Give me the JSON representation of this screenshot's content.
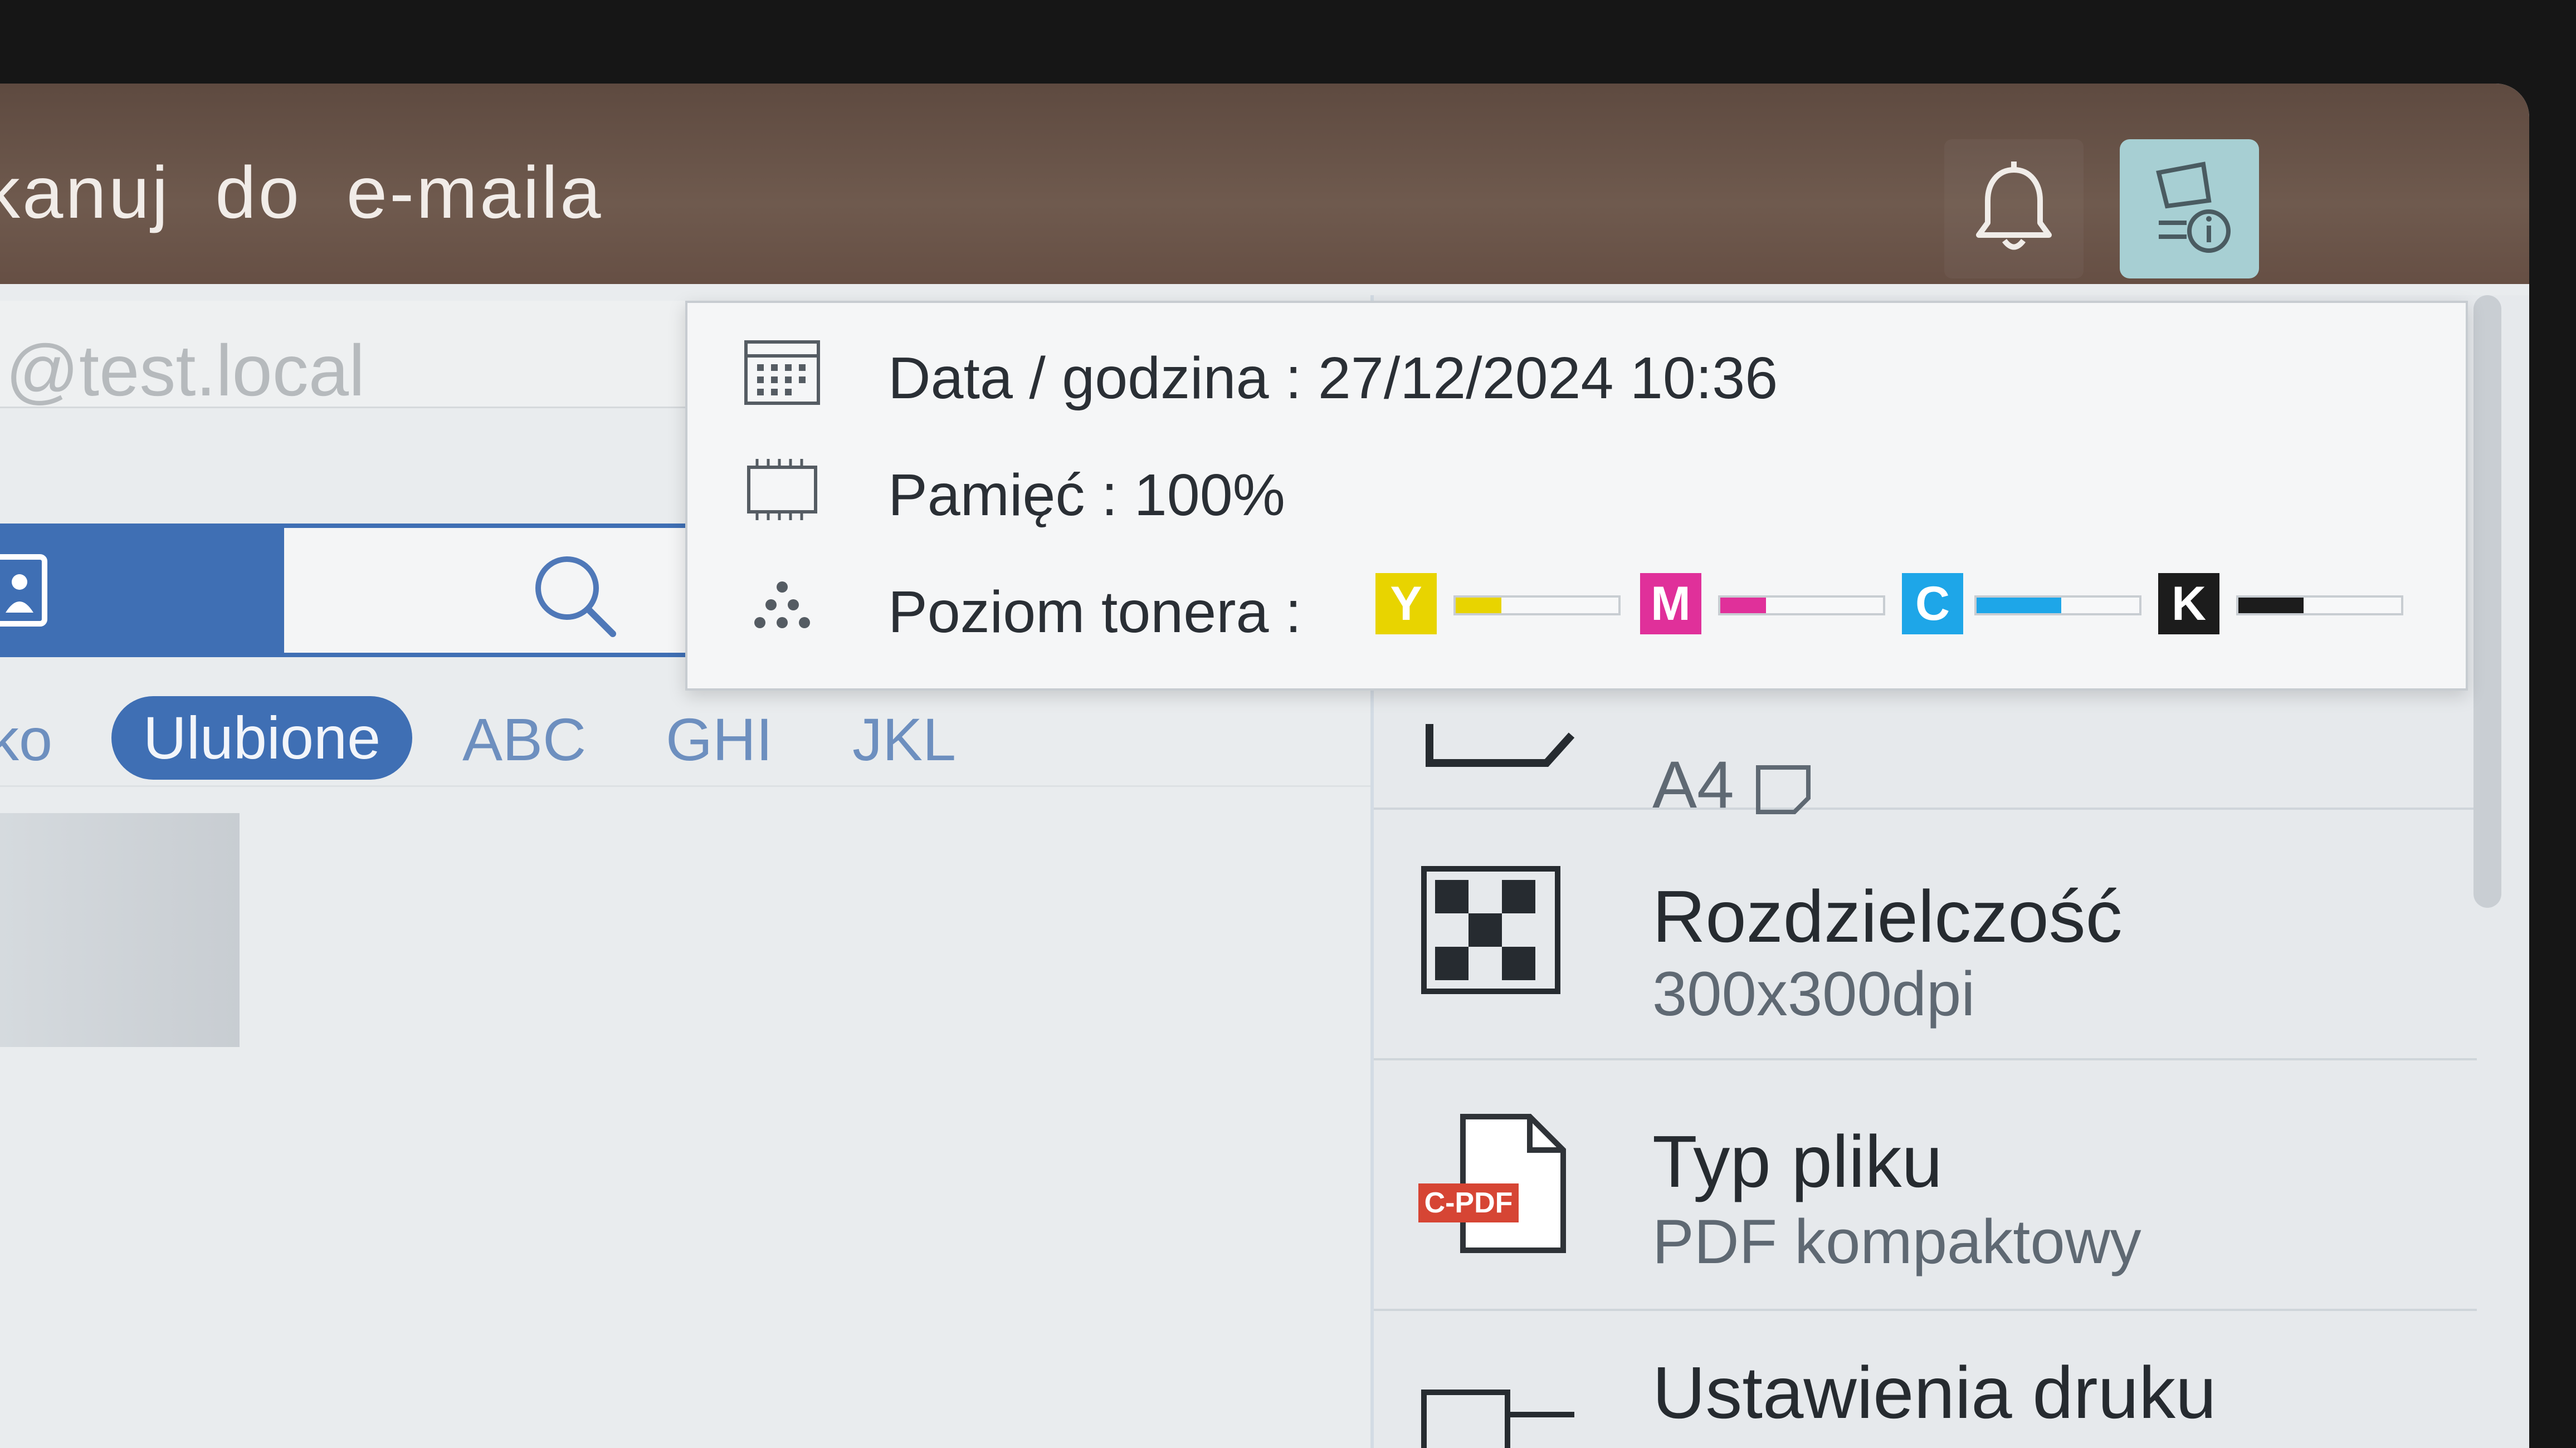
{
  "header": {
    "title": "kanuj do e-maila",
    "icons": {
      "bell": "bell-icon",
      "device_info": "device-info-icon"
    }
  },
  "email": {
    "value": "@test.local"
  },
  "search": {
    "icon": "search-icon"
  },
  "filters": {
    "partial": "ko",
    "favorites": "Ulubione",
    "abc": "ABC",
    "ghi": "GHI",
    "jkl": "JKL"
  },
  "settings": {
    "size_value": "A4",
    "resolution_title": "Rozdzielczość",
    "resolution_value": "300x300dpi",
    "filetype_title": "Typ pliku",
    "filetype_value": "PDF kompaktowy",
    "filetype_badge": "C-PDF",
    "print_title": "Ustawienia druku"
  },
  "status": {
    "datetime": "Data / godzina : 27/12/2024 10:36",
    "memory": "Pamięć : 100%",
    "toner_label": "Poziom tonera :",
    "toner": [
      {
        "letter": "Y",
        "level": 0.28,
        "color": "#e8d400"
      },
      {
        "letter": "M",
        "level": 0.28,
        "color": "#e0309a"
      },
      {
        "letter": "C",
        "level": 0.52,
        "color": "#1ea6e8"
      },
      {
        "letter": "K",
        "level": 0.4,
        "color": "#1c1c1c"
      }
    ]
  },
  "colors": {
    "accent": "#3f6fb4",
    "header_bg": "#6a5448",
    "device_info_bg": "#a7cfd3"
  }
}
